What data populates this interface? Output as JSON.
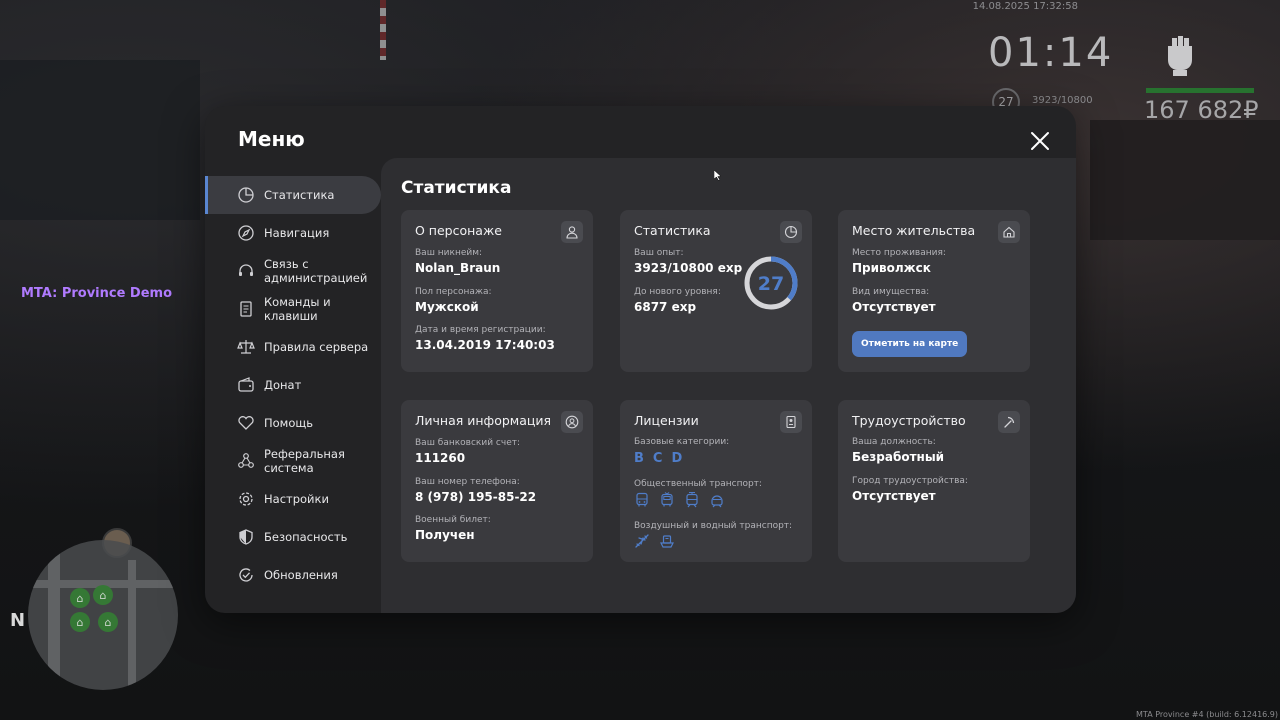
{
  "hud": {
    "datetime": "14.08.2025 17:32:58",
    "clock": "01:14",
    "level": "27",
    "exp": "3923/10800",
    "money": "167 682₽",
    "server_label": "MTA: Province Demo",
    "build": "MTA Province #4 (build: 6.12416.9)",
    "minimap_north": "N",
    "colors": {
      "health_bar": "#27722f",
      "server_label": "#b07bff"
    }
  },
  "menu": {
    "title": "Меню",
    "nav": [
      {
        "label": "Статистика",
        "icon": "pie-chart-icon",
        "active": true
      },
      {
        "label": "Навигация",
        "icon": "compass-icon"
      },
      {
        "label": "Связь с администрацией",
        "icon": "headset-icon"
      },
      {
        "label": "Команды и клавиши",
        "icon": "document-icon"
      },
      {
        "label": "Правила сервера",
        "icon": "scales-icon"
      },
      {
        "label": "Донат",
        "icon": "wallet-icon"
      },
      {
        "label": "Помощь",
        "icon": "heart-handshake-icon"
      },
      {
        "label": "Реферальная система",
        "icon": "network-icon"
      },
      {
        "label": "Настройки",
        "icon": "gear-icon"
      },
      {
        "label": "Безопасность",
        "icon": "shield-icon"
      },
      {
        "label": "Обновления",
        "icon": "refresh-check-icon"
      }
    ],
    "accent_color": "#5a86d1"
  },
  "stats": {
    "title": "Статистика",
    "character": {
      "title": "О персонаже",
      "nickname_label": "Ваш никнейм:",
      "nickname": "Nolan_Braun",
      "gender_label": "Пол персонажа:",
      "gender": "Мужской",
      "reg_label": "Дата и время регистрации:",
      "reg_date": "13.04.2019 17:40:03"
    },
    "statistics": {
      "title": "Статистика",
      "exp_label": "Ваш опыт:",
      "exp": "3923/10800 exp",
      "next_label": "До нового уровня:",
      "next": "6877 exp",
      "level": "27",
      "level_progress": 0.363
    },
    "residence": {
      "title": "Место жительства",
      "place_label": "Место проживания:",
      "place": "Приволжск",
      "property_label": "Вид имущества:",
      "property": "Отсутствует",
      "map_button": "Отметить на карте"
    },
    "personal": {
      "title": "Личная информация",
      "bank_label": "Ваш банковский счет:",
      "bank": "111260",
      "phone_label": "Ваш номер телефона:",
      "phone": "8 (978) 195-85-22",
      "military_label": "Военный билет:",
      "military": "Получен"
    },
    "licenses": {
      "title": "Лицензии",
      "base_label": "Базовые категории:",
      "categories": [
        "B",
        "C",
        "D"
      ],
      "public_label": "Общественный транспорт:",
      "public_icons": [
        "bus-icon",
        "trolleybus-icon",
        "tram-icon",
        "metro-icon"
      ],
      "air_label": "Воздушный и водный транспорт:",
      "air_icons": [
        "airplane-icon",
        "boat-icon"
      ]
    },
    "employment": {
      "title": "Трудоустройство",
      "position_label": "Ваша должность:",
      "position": "Безработный",
      "city_label": "Город трудоустройства:",
      "city": "Отсутствует"
    }
  }
}
